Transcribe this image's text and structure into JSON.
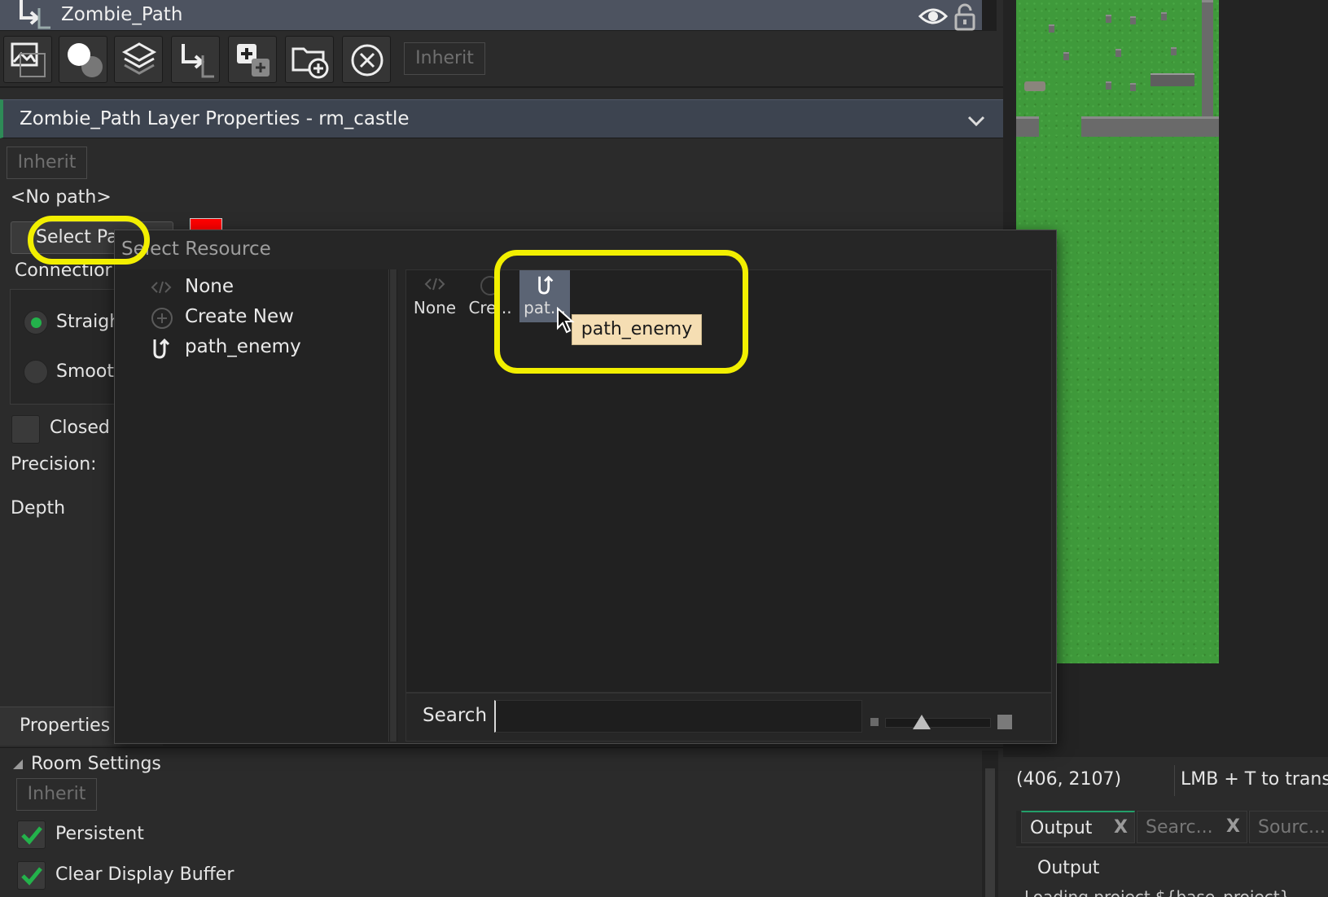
{
  "layer_header": {
    "title": "Zombie_Path"
  },
  "toolbar": {
    "buttons": [
      "add-background-layer",
      "add-instance-layer",
      "add-tile-layer",
      "add-path-layer",
      "add-asset-layer",
      "add-folder",
      "delete-layer"
    ],
    "inherit_label": "Inherit"
  },
  "layer_properties": {
    "title": "Zombie_Path Layer Properties - rm_castle",
    "inherit_label": "Inherit",
    "path_value": "<No path>",
    "select_path_label": "Select Pa",
    "path_color": "#ff0000",
    "connection_label": "Connectior",
    "straight_label": "Straigh",
    "smooth_label": "Smoot",
    "closed_label": "Closed",
    "precision_label": "Precision:",
    "depth_label": "Depth"
  },
  "select_resource": {
    "title": "Select Resource",
    "list": [
      {
        "label": "None",
        "icon": "code-icon"
      },
      {
        "label": "Create New",
        "icon": "plus-circle-icon"
      },
      {
        "label": "path_enemy",
        "icon": "path-icon"
      }
    ],
    "grid": [
      {
        "label": "None",
        "icon": "code-icon"
      },
      {
        "label": "Cre...",
        "icon": "plus-circle-icon"
      },
      {
        "label": "pat...",
        "icon": "path-icon",
        "selected": true
      }
    ],
    "tooltip": "path_enemy",
    "search_label": "Search",
    "search_value": ""
  },
  "properties_panel": {
    "tab_label": "Properties",
    "section_label": "Room Settings",
    "inherit_label": "Inherit",
    "persistent_label": "Persistent",
    "persistent_checked": true,
    "clear_label": "Clear Display Buffer",
    "clear_checked": true
  },
  "room_view": {
    "coordinates": "(406, 2107)",
    "hint": "LMB + T to trans"
  },
  "output": {
    "tabs": [
      {
        "label": "Output",
        "active": true
      },
      {
        "label": "Searc..."
      },
      {
        "label": "Sourc..."
      }
    ],
    "title": "Output",
    "log_line": "Loading project ${base_project}..."
  },
  "colors": {
    "accent_green": "#23b24b",
    "highlight_yellow": "#f2ef00",
    "tooltip_bg": "#f5deb3",
    "selected_item": "#5b6474"
  }
}
